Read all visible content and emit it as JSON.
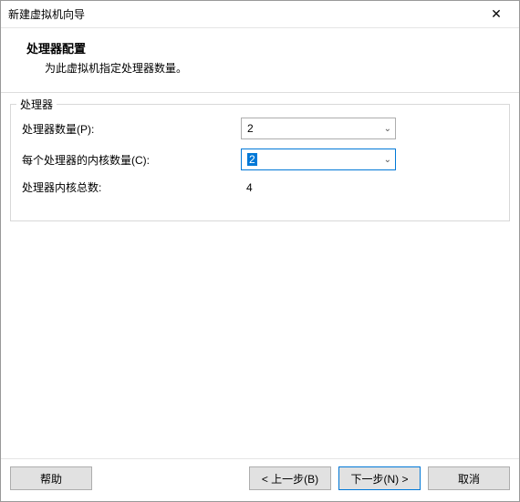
{
  "window": {
    "title": "新建虚拟机向导"
  },
  "header": {
    "title": "处理器配置",
    "subtitle": "为此虚拟机指定处理器数量。"
  },
  "fieldset": {
    "legend": "处理器",
    "processors_label": "处理器数量(P):",
    "processors_value": "2",
    "cores_label": "每个处理器的内核数量(C):",
    "cores_value": "2",
    "total_label": "处理器内核总数:",
    "total_value": "4"
  },
  "buttons": {
    "help": "帮助",
    "back": "< 上一步(B)",
    "next": "下一步(N) >",
    "cancel": "取消"
  }
}
